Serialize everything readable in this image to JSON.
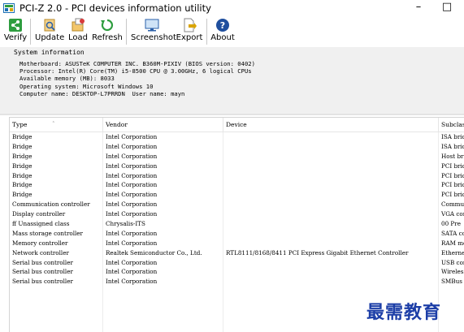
{
  "window": {
    "title": "PCI-Z 2.0  - PCI devices information utility",
    "minimize": "–",
    "maximize": "□"
  },
  "toolbar": {
    "verify": "Verify",
    "update": "Update",
    "load": "Load",
    "refresh": "Refresh",
    "screenshot": "Screenshot",
    "export": "Export",
    "about": "About"
  },
  "system_info": {
    "label": "System information",
    "lines": [
      "Motherboard: ASUSTeK COMPUTER INC. B360M-PIXIV (BIOS version: 0402)",
      "Processor: Intel(R) Core(TM) i5-8500 CPU @ 3.00GHz, 6 logical CPUs",
      "Available memory (MB): 8033",
      "Operating system: Microsoft Windows 10",
      "Computer name: DESKTOP-L7PRRDN  User name: mayn"
    ]
  },
  "table": {
    "columns": [
      "Type",
      "Vendor",
      "Device",
      "Subclass"
    ],
    "rows": [
      [
        "Bridge",
        "Intel Corporation",
        "",
        "ISA bridge"
      ],
      [
        "Bridge",
        "Intel Corporation",
        "",
        "ISA bridge"
      ],
      [
        "Bridge",
        "Intel Corporation",
        "",
        "Host bridge"
      ],
      [
        "Bridge",
        "Intel Corporation",
        "",
        "PCI bridge"
      ],
      [
        "Bridge",
        "Intel Corporation",
        "",
        "PCI bridge"
      ],
      [
        "Bridge",
        "Intel Corporation",
        "",
        "PCI bridge"
      ],
      [
        "Bridge",
        "Intel Corporation",
        "",
        "PCI bridge"
      ],
      [
        "Communication controller",
        "Intel Corporation",
        "",
        "Communication"
      ],
      [
        "Display controller",
        "Intel Corporation",
        "",
        "VGA compatible"
      ],
      [
        "ff  Unassigned class",
        "Chrysalis-ITS",
        "",
        "00  Pre"
      ],
      [
        "Mass storage controller",
        "Intel Corporation",
        "",
        "SATA controller"
      ],
      [
        "Memory controller",
        "Intel Corporation",
        "",
        "RAM memory"
      ],
      [
        "Network controller",
        "Realtek Semiconductor Co., Ltd.",
        "RTL8111/8168/8411 PCI Express Gigabit Ethernet Controller",
        "Ethernet"
      ],
      [
        "Serial bus controller",
        "Intel Corporation",
        "",
        "USB controller"
      ],
      [
        "Serial bus controller",
        "Intel Corporation",
        "",
        "Wireless"
      ],
      [
        "Serial bus controller",
        "Intel Corporation",
        "",
        "SMBus"
      ]
    ]
  },
  "watermark": "最需教育"
}
